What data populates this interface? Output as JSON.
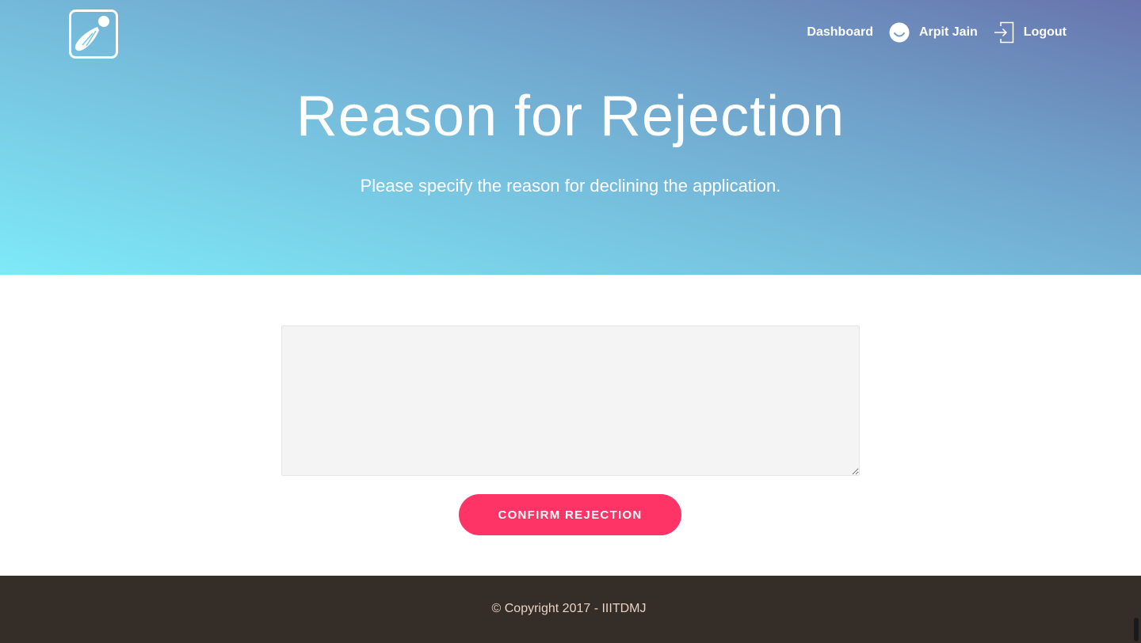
{
  "header": {
    "logo_icon": "shuttlecock-icon",
    "nav": {
      "dashboard_label": "Dashboard",
      "user_name": "Arpit Jain",
      "user_icon": "smiley-icon",
      "logout_label": "Logout",
      "logout_icon": "logout-icon"
    }
  },
  "hero": {
    "title": "Reason for Rejection",
    "subtitle": "Please specify the reason for declining the application."
  },
  "form": {
    "reason_value": "",
    "reason_placeholder": "",
    "confirm_label": "CONFIRM REJECTION"
  },
  "footer": {
    "copyright": "© Copyright 2017 - IIITDMJ"
  },
  "colors": {
    "accent": "#fe3466",
    "gradient_start": "#7eeaf8",
    "gradient_end": "#6874ad",
    "footer_bg": "#352e28",
    "footer_text": "#e9d2c4",
    "textarea_bg": "#f4f4f4"
  }
}
